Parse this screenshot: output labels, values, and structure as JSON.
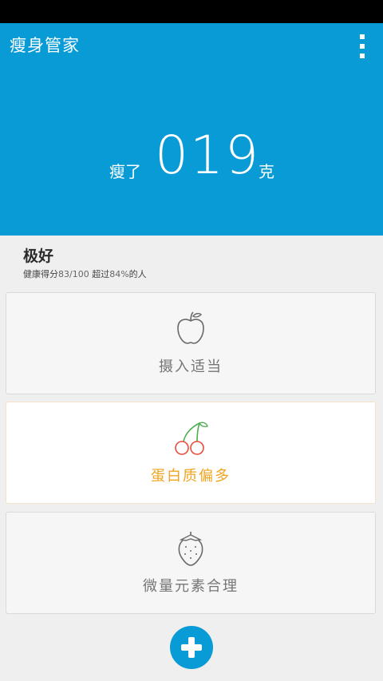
{
  "header": {
    "title": "瘦身管家",
    "menu_icon": "more-vert-icon",
    "background_color": "#099bd5"
  },
  "weight": {
    "prefix": "瘦了",
    "value": "019",
    "unit": "克"
  },
  "summary": {
    "rating": "极好",
    "score_label": "健康得分",
    "score": "83/100",
    "exceed_label": "超过",
    "percent": "84%",
    "suffix": "的人"
  },
  "cards": [
    {
      "icon": "apple-icon",
      "label": "摄入适当",
      "highlighted": false
    },
    {
      "icon": "cherry-icon",
      "label": "蛋白质偏多",
      "highlighted": true,
      "label_color": "#f0a41e"
    },
    {
      "icon": "strawberry-icon",
      "label": "微量元素合理",
      "highlighted": false
    }
  ],
  "fab": {
    "icon": "plus-icon"
  }
}
